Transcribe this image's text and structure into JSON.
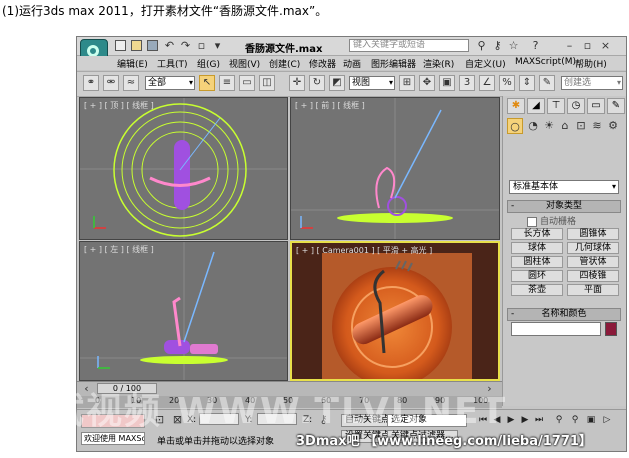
{
  "caption": "(1)运行3ds max 2011，打开素材文件“香肠源文件.max”。",
  "titlebar": {
    "title": "香肠源文件.max",
    "search_placeholder": "键入关键字或短语"
  },
  "menu": {
    "items": [
      "编辑(E)",
      "工具(T)",
      "组(G)",
      "视图(V)",
      "创建(C)",
      "修改器",
      "动画",
      "图形编辑器",
      "渲染(R)",
      "自定义(U)",
      "MAXScript(M)",
      "帮助(H)"
    ]
  },
  "toolbar": {
    "selection_filter": "全部",
    "reference_coord": "视图",
    "selection_set_label": "创建选"
  },
  "viewports": {
    "top": "[ + ] [ 顶 ] [ 线框 ]",
    "front": "[ + ] [ 前 ] [ 线框 ]",
    "left": "[ + ] [ 左 ] [ 线框 ]",
    "camera": "[ + ] [ Camera001 ] [ 平滑 + 高光 ]"
  },
  "command_panel": {
    "category": "标准基本体",
    "object_type_title": "对象类型",
    "autogrid": "自动栅格",
    "objects": [
      "长方体",
      "圆锥体",
      "球体",
      "几何球体",
      "圆柱体",
      "管状体",
      "圆环",
      "四棱锥",
      "茶壶",
      "平面"
    ],
    "name_color_title": "名称和颜色",
    "object_color": "#8b1a3a"
  },
  "timeline": {
    "frame": "0 / 100",
    "ticks": [
      "0",
      "10",
      "20",
      "30",
      "40",
      "50",
      "60",
      "70",
      "80",
      "90",
      "100"
    ]
  },
  "statusbar": {
    "x_label": "X:",
    "y_label": "Y:",
    "z_label": "Z:",
    "auto_key": "自动关键点",
    "selected_set": "选定对象",
    "set_key": "设置关键点",
    "key_filters": "关键点过滤器...",
    "welcome": "欢迎使用 MAXSc",
    "hint": "单击或单击并拖动以选择对象"
  },
  "watermarks": {
    "main": "调试视频 WWW.TLVI.NET",
    "bottom": "3Dmax吧 【www.lineeg.com/lieba/1771】"
  },
  "colors": {
    "viewport_bg": "#737373",
    "active_border": "#e8e04a",
    "plate_green": "#c8ff30",
    "sausage_purple": "#a050e0"
  }
}
